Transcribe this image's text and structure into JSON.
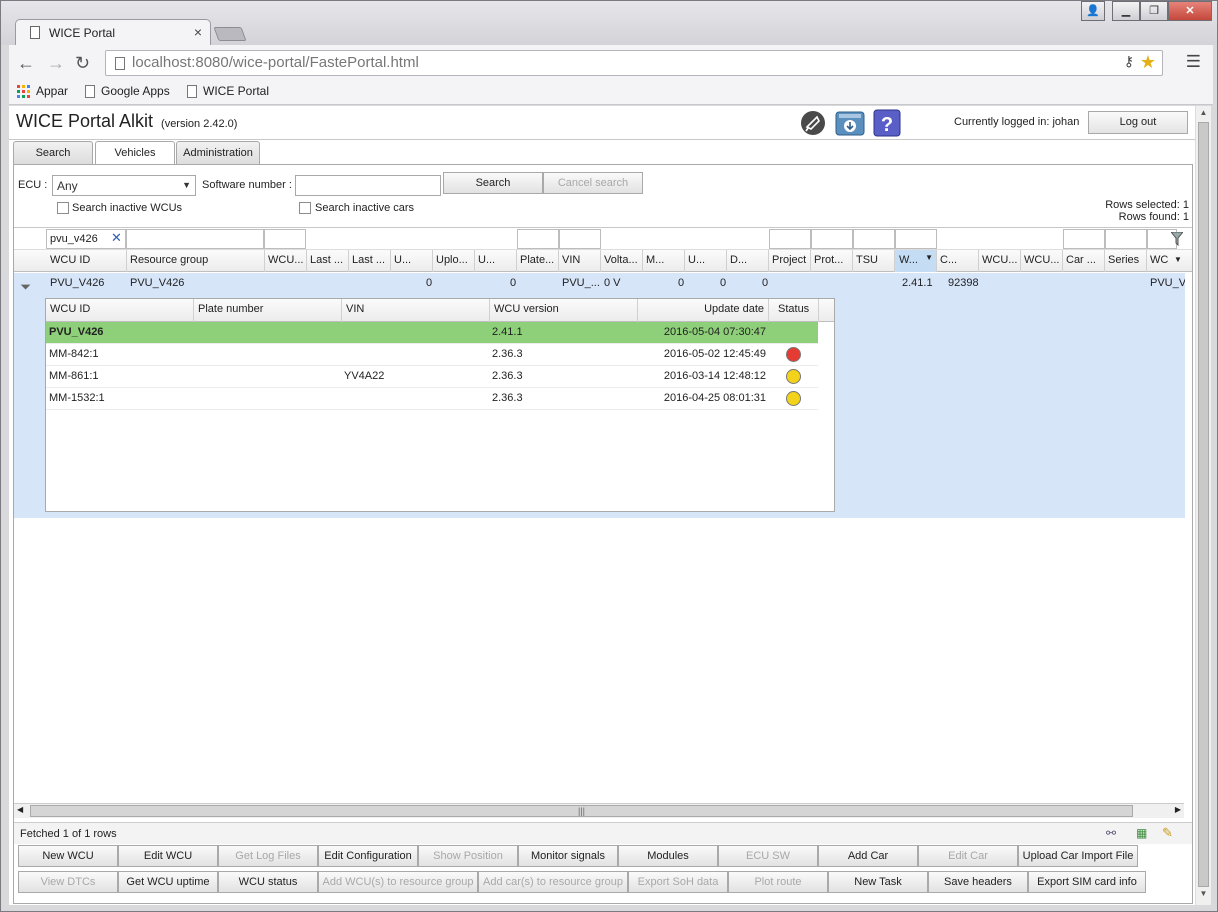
{
  "browser": {
    "tab_title": "WICE Portal",
    "url_host": "localhost",
    "url_rest": ":8080/wice-portal/FastePortal.html",
    "bookmarks": [
      "Appar",
      "Google Apps",
      "WICE Portal"
    ]
  },
  "app": {
    "title": "WICE Portal Alkit",
    "version": "(version 2.42.0)",
    "logged_in": "Currently logged in: johan",
    "logout": "Log out",
    "tabs": [
      "Search",
      "Vehicles",
      "Administration"
    ]
  },
  "search": {
    "ecu_label": "ECU :",
    "ecu_value": "Any",
    "software_label": "Software number :",
    "search_btn": "Search",
    "cancel_btn": "Cancel search",
    "inactive_wcus": "Search inactive WCUs",
    "inactive_cars": "Search inactive cars",
    "rows_selected": "Rows selected: 1",
    "rows_found": "Rows found: 1",
    "filter_value": "pvu_v426"
  },
  "grid": {
    "headers": [
      "WCU ID",
      "Resource group",
      "WCU...",
      "Last ...",
      "Last ...",
      "U...",
      "Uplo...",
      "U...",
      "Plate...",
      "VIN",
      "Volta...",
      "M...",
      "U...",
      "D...",
      "Project",
      "Prot...",
      "TSU",
      "W...",
      "C...",
      "WCU...",
      "WCU...",
      "Car ...",
      "Series",
      "WC"
    ],
    "row": [
      "PVU_V426",
      "PVU_V426",
      "0",
      "0",
      "PVU_...",
      "0 V",
      "0",
      "0",
      "0",
      "2.41.1",
      "92398",
      "PVU_V4"
    ]
  },
  "subtable": {
    "headers": [
      "WCU ID",
      "Plate number",
      "VIN",
      "WCU version",
      "Update date",
      "Status"
    ],
    "rows": [
      {
        "id": "PVU_V426",
        "plate": "",
        "vin": "",
        "version": "2.41.1",
        "date": "2016-05-04 07:30:47",
        "status": ""
      },
      {
        "id": "MM-842:1",
        "plate": "",
        "vin": "",
        "version": "2.36.3",
        "date": "2016-05-02 12:45:49",
        "status": "red"
      },
      {
        "id": "MM-861:1",
        "plate": "",
        "vin": "YV4A22",
        "version": "2.36.3",
        "date": "2016-03-14 12:48:12",
        "status": "yellow"
      },
      {
        "id": "MM-1532:1",
        "plate": "",
        "vin": "",
        "version": "2.36.3",
        "date": "2016-04-25 08:01:31",
        "status": "yellow"
      }
    ]
  },
  "status_bar": {
    "fetched": "Fetched 1 of 1 rows"
  },
  "buttons_row1": [
    "New WCU",
    "Edit WCU",
    "Get Log Files",
    "Edit Configuration",
    "Show Position",
    "Monitor signals",
    "Modules",
    "ECU SW",
    "Add Car",
    "Edit Car",
    "Upload Car Import File"
  ],
  "buttons_row2": [
    "View DTCs",
    "Get WCU uptime",
    "WCU status",
    "Add WCU(s) to resource group",
    "Add car(s) to resource group",
    "Export SoH data",
    "Plot route",
    "New Task",
    "Save headers",
    "Export SIM card info"
  ],
  "colors": {
    "selected_row": "#d7e5f9",
    "green_row": "#8ecf7a",
    "status_red": "#e53b33",
    "status_yellow": "#f2d21a"
  }
}
